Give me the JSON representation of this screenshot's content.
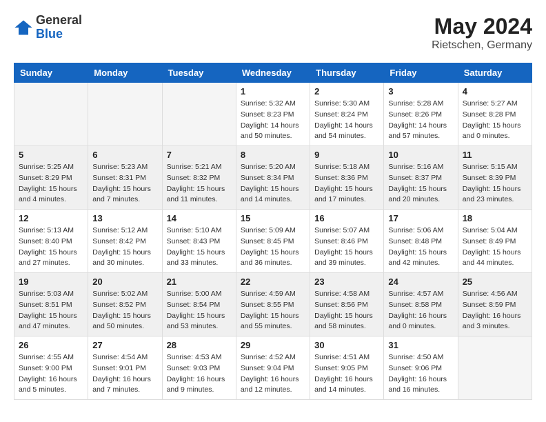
{
  "header": {
    "logo": {
      "general": "General",
      "blue": "Blue"
    },
    "title": "May 2024",
    "location": "Rietschen, Germany"
  },
  "weekdays": [
    "Sunday",
    "Monday",
    "Tuesday",
    "Wednesday",
    "Thursday",
    "Friday",
    "Saturday"
  ],
  "weeks": [
    [
      {
        "day": "",
        "sunrise": "",
        "sunset": "",
        "daylight": ""
      },
      {
        "day": "",
        "sunrise": "",
        "sunset": "",
        "daylight": ""
      },
      {
        "day": "",
        "sunrise": "",
        "sunset": "",
        "daylight": ""
      },
      {
        "day": "1",
        "sunrise": "Sunrise: 5:32 AM",
        "sunset": "Sunset: 8:23 PM",
        "daylight": "Daylight: 14 hours and 50 minutes."
      },
      {
        "day": "2",
        "sunrise": "Sunrise: 5:30 AM",
        "sunset": "Sunset: 8:24 PM",
        "daylight": "Daylight: 14 hours and 54 minutes."
      },
      {
        "day": "3",
        "sunrise": "Sunrise: 5:28 AM",
        "sunset": "Sunset: 8:26 PM",
        "daylight": "Daylight: 14 hours and 57 minutes."
      },
      {
        "day": "4",
        "sunrise": "Sunrise: 5:27 AM",
        "sunset": "Sunset: 8:28 PM",
        "daylight": "Daylight: 15 hours and 0 minutes."
      }
    ],
    [
      {
        "day": "5",
        "sunrise": "Sunrise: 5:25 AM",
        "sunset": "Sunset: 8:29 PM",
        "daylight": "Daylight: 15 hours and 4 minutes."
      },
      {
        "day": "6",
        "sunrise": "Sunrise: 5:23 AM",
        "sunset": "Sunset: 8:31 PM",
        "daylight": "Daylight: 15 hours and 7 minutes."
      },
      {
        "day": "7",
        "sunrise": "Sunrise: 5:21 AM",
        "sunset": "Sunset: 8:32 PM",
        "daylight": "Daylight: 15 hours and 11 minutes."
      },
      {
        "day": "8",
        "sunrise": "Sunrise: 5:20 AM",
        "sunset": "Sunset: 8:34 PM",
        "daylight": "Daylight: 15 hours and 14 minutes."
      },
      {
        "day": "9",
        "sunrise": "Sunrise: 5:18 AM",
        "sunset": "Sunset: 8:36 PM",
        "daylight": "Daylight: 15 hours and 17 minutes."
      },
      {
        "day": "10",
        "sunrise": "Sunrise: 5:16 AM",
        "sunset": "Sunset: 8:37 PM",
        "daylight": "Daylight: 15 hours and 20 minutes."
      },
      {
        "day": "11",
        "sunrise": "Sunrise: 5:15 AM",
        "sunset": "Sunset: 8:39 PM",
        "daylight": "Daylight: 15 hours and 23 minutes."
      }
    ],
    [
      {
        "day": "12",
        "sunrise": "Sunrise: 5:13 AM",
        "sunset": "Sunset: 8:40 PM",
        "daylight": "Daylight: 15 hours and 27 minutes."
      },
      {
        "day": "13",
        "sunrise": "Sunrise: 5:12 AM",
        "sunset": "Sunset: 8:42 PM",
        "daylight": "Daylight: 15 hours and 30 minutes."
      },
      {
        "day": "14",
        "sunrise": "Sunrise: 5:10 AM",
        "sunset": "Sunset: 8:43 PM",
        "daylight": "Daylight: 15 hours and 33 minutes."
      },
      {
        "day": "15",
        "sunrise": "Sunrise: 5:09 AM",
        "sunset": "Sunset: 8:45 PM",
        "daylight": "Daylight: 15 hours and 36 minutes."
      },
      {
        "day": "16",
        "sunrise": "Sunrise: 5:07 AM",
        "sunset": "Sunset: 8:46 PM",
        "daylight": "Daylight: 15 hours and 39 minutes."
      },
      {
        "day": "17",
        "sunrise": "Sunrise: 5:06 AM",
        "sunset": "Sunset: 8:48 PM",
        "daylight": "Daylight: 15 hours and 42 minutes."
      },
      {
        "day": "18",
        "sunrise": "Sunrise: 5:04 AM",
        "sunset": "Sunset: 8:49 PM",
        "daylight": "Daylight: 15 hours and 44 minutes."
      }
    ],
    [
      {
        "day": "19",
        "sunrise": "Sunrise: 5:03 AM",
        "sunset": "Sunset: 8:51 PM",
        "daylight": "Daylight: 15 hours and 47 minutes."
      },
      {
        "day": "20",
        "sunrise": "Sunrise: 5:02 AM",
        "sunset": "Sunset: 8:52 PM",
        "daylight": "Daylight: 15 hours and 50 minutes."
      },
      {
        "day": "21",
        "sunrise": "Sunrise: 5:00 AM",
        "sunset": "Sunset: 8:54 PM",
        "daylight": "Daylight: 15 hours and 53 minutes."
      },
      {
        "day": "22",
        "sunrise": "Sunrise: 4:59 AM",
        "sunset": "Sunset: 8:55 PM",
        "daylight": "Daylight: 15 hours and 55 minutes."
      },
      {
        "day": "23",
        "sunrise": "Sunrise: 4:58 AM",
        "sunset": "Sunset: 8:56 PM",
        "daylight": "Daylight: 15 hours and 58 minutes."
      },
      {
        "day": "24",
        "sunrise": "Sunrise: 4:57 AM",
        "sunset": "Sunset: 8:58 PM",
        "daylight": "Daylight: 16 hours and 0 minutes."
      },
      {
        "day": "25",
        "sunrise": "Sunrise: 4:56 AM",
        "sunset": "Sunset: 8:59 PM",
        "daylight": "Daylight: 16 hours and 3 minutes."
      }
    ],
    [
      {
        "day": "26",
        "sunrise": "Sunrise: 4:55 AM",
        "sunset": "Sunset: 9:00 PM",
        "daylight": "Daylight: 16 hours and 5 minutes."
      },
      {
        "day": "27",
        "sunrise": "Sunrise: 4:54 AM",
        "sunset": "Sunset: 9:01 PM",
        "daylight": "Daylight: 16 hours and 7 minutes."
      },
      {
        "day": "28",
        "sunrise": "Sunrise: 4:53 AM",
        "sunset": "Sunset: 9:03 PM",
        "daylight": "Daylight: 16 hours and 9 minutes."
      },
      {
        "day": "29",
        "sunrise": "Sunrise: 4:52 AM",
        "sunset": "Sunset: 9:04 PM",
        "daylight": "Daylight: 16 hours and 12 minutes."
      },
      {
        "day": "30",
        "sunrise": "Sunrise: 4:51 AM",
        "sunset": "Sunset: 9:05 PM",
        "daylight": "Daylight: 16 hours and 14 minutes."
      },
      {
        "day": "31",
        "sunrise": "Sunrise: 4:50 AM",
        "sunset": "Sunset: 9:06 PM",
        "daylight": "Daylight: 16 hours and 16 minutes."
      },
      {
        "day": "",
        "sunrise": "",
        "sunset": "",
        "daylight": ""
      }
    ]
  ]
}
